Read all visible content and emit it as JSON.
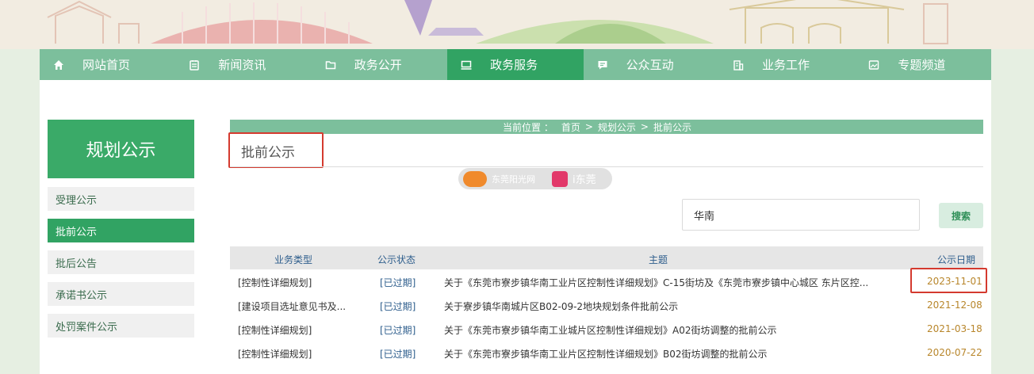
{
  "nav": [
    {
      "label": "网站首页",
      "icon": "home-icon"
    },
    {
      "label": "新闻资讯",
      "icon": "news-icon"
    },
    {
      "label": "政务公开",
      "icon": "folder-icon"
    },
    {
      "label": "政务服务",
      "icon": "monitor-icon",
      "active": true
    },
    {
      "label": "公众互动",
      "icon": "chat-icon"
    },
    {
      "label": "业务工作",
      "icon": "building-icon"
    },
    {
      "label": "专题频道",
      "icon": "image-icon"
    }
  ],
  "sidebar": {
    "title": "规划公示",
    "items": [
      {
        "label": "受理公示"
      },
      {
        "label": "批前公示",
        "active": true
      },
      {
        "label": "批后公告"
      },
      {
        "label": "承诺书公示"
      },
      {
        "label": "处罚案件公示"
      }
    ]
  },
  "breadcrumb": {
    "prefix": "当前位置 ：",
    "items": [
      "首页",
      ">",
      "规划公示",
      ">",
      "批前公示"
    ]
  },
  "page_title": "批前公示",
  "watermark": {
    "text1": "东莞阳光网",
    "text2": "i东莞"
  },
  "search": {
    "value": "华南",
    "button": "搜索"
  },
  "table": {
    "headers": {
      "type": "业务类型",
      "status": "公示状态",
      "subject": "主题",
      "date": "公示日期"
    },
    "rows": [
      {
        "type": "[控制性详细规划]",
        "status": "[已过期]",
        "subject": "关于《东莞市寮步镇华南工业片区控制性详细规划》C-15街坊及《东莞市寮步镇中心城区 东片区控...",
        "date": "2023-11-01"
      },
      {
        "type": "[建设项目选址意见书及...",
        "status": "[已过期]",
        "subject": "关于寮步镇华南城片区B02-09-2地块规划条件批前公示",
        "date": "2021-12-08"
      },
      {
        "type": "[控制性详细规划]",
        "status": "[已过期]",
        "subject": "关于《东莞市寮步镇华南工业城片区控制性详细规划》A02街坊调整的批前公示",
        "date": "2021-03-18"
      },
      {
        "type": "[控制性详细规划]",
        "status": "[已过期]",
        "subject": "关于《东莞市寮步镇华南工业片区控制性详细规划》B02街坊调整的批前公示",
        "date": "2020-07-22"
      }
    ]
  },
  "colors": {
    "nav": "#7cbf9c",
    "nav_active": "#31a363",
    "highlight": "#d43a2f",
    "date": "#b8862b"
  }
}
